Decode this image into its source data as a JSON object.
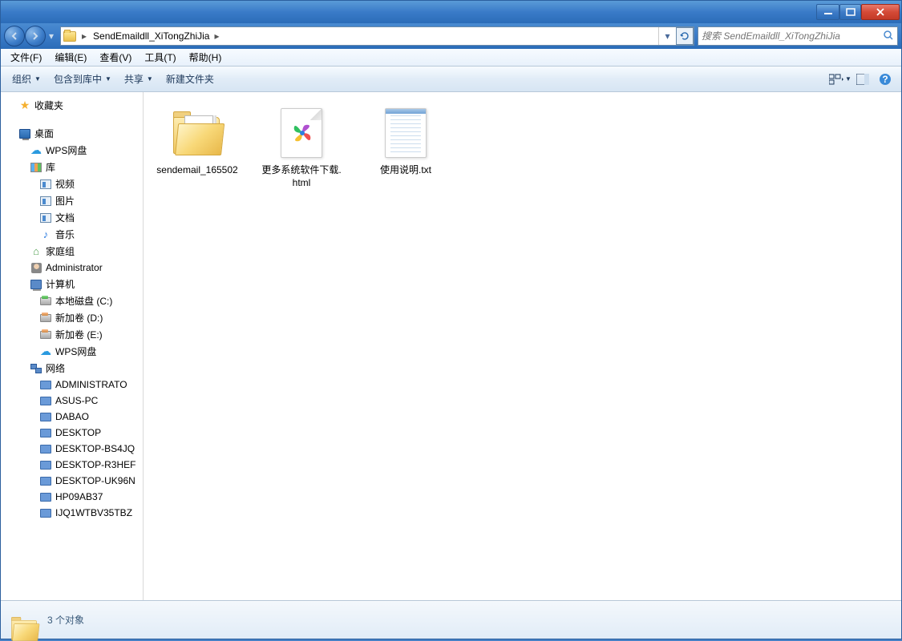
{
  "titlebar": {
    "minimize": "—",
    "maximize": "▢",
    "close": "✕"
  },
  "nav": {
    "path_root_sep": "▸",
    "path_folder": "SendEmaildll_XiTongZhiJia",
    "path_sep": "▸",
    "dropdown": "▾",
    "refresh": "↻"
  },
  "search": {
    "placeholder": "搜索 SendEmaildll_XiTongZhiJia"
  },
  "menubar": [
    {
      "label": "文件(F)"
    },
    {
      "label": "编辑(E)"
    },
    {
      "label": "查看(V)"
    },
    {
      "label": "工具(T)"
    },
    {
      "label": "帮助(H)"
    }
  ],
  "toolbar": {
    "organize": "组织",
    "include": "包含到库中",
    "share": "共享",
    "newfolder": "新建文件夹"
  },
  "sidebar": {
    "favorites": "收藏夹",
    "desktop": "桌面",
    "wps": "WPS网盘",
    "libraries": "库",
    "videos": "视频",
    "pictures": "图片",
    "documents": "文档",
    "music": "音乐",
    "homegroup": "家庭组",
    "admin": "Administrator",
    "computer": "计算机",
    "drive_c": "本地磁盘 (C:)",
    "drive_d": "新加卷 (D:)",
    "drive_e": "新加卷 (E:)",
    "wps2": "WPS网盘",
    "network": "网络",
    "net_items": [
      "ADMINISTRATO",
      "ASUS-PC",
      "DABAO",
      "DESKTOP",
      "DESKTOP-BS4JQ",
      "DESKTOP-R3HEF",
      "DESKTOP-UK96N",
      "HP09AB37",
      "IJQ1WTBV35TBZ"
    ]
  },
  "files": [
    {
      "name": "sendemail_165502",
      "type": "folder"
    },
    {
      "name": "更多系统软件下载.html",
      "type": "html"
    },
    {
      "name": "使用说明.txt",
      "type": "txt"
    }
  ],
  "statusbar": {
    "count": "3 个对象"
  }
}
